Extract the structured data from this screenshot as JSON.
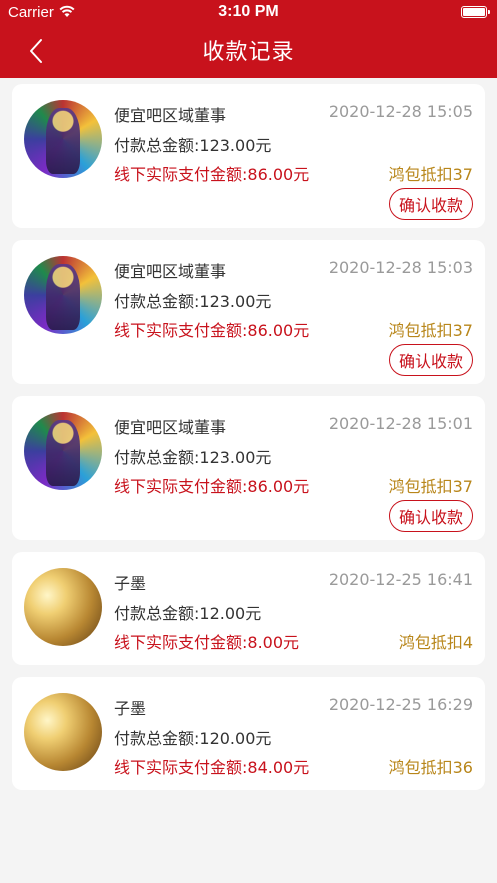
{
  "status_bar": {
    "carrier": "Carrier",
    "time": "3:10 PM"
  },
  "header": {
    "title": "收款记录"
  },
  "colors": {
    "brand": "#c8121c",
    "deduct": "#b8861a"
  },
  "records": [
    {
      "name": "便宜吧区域董事",
      "date": "2020-12-28 15:05",
      "total": "付款总金额:123.00元",
      "actual": "线下实际支付金额:86.00元",
      "deduct": "鸿包抵扣37",
      "confirm": "确认收款"
    },
    {
      "name": "便宜吧区域董事",
      "date": "2020-12-28 15:03",
      "total": "付款总金额:123.00元",
      "actual": "线下实际支付金额:86.00元",
      "deduct": "鸿包抵扣37",
      "confirm": "确认收款"
    },
    {
      "name": "便宜吧区域董事",
      "date": "2020-12-28 15:01",
      "total": "付款总金额:123.00元",
      "actual": "线下实际支付金额:86.00元",
      "deduct": "鸿包抵扣37",
      "confirm": "确认收款"
    },
    {
      "name": "子墨",
      "date": "2020-12-25 16:41",
      "total": "付款总金额:12.00元",
      "actual": "线下实际支付金额:8.00元",
      "deduct": "鸿包抵扣4"
    },
    {
      "name": "子墨",
      "date": "2020-12-25 16:29",
      "total": "付款总金额:120.00元",
      "actual": "线下实际支付金额:84.00元",
      "deduct": "鸿包抵扣36"
    }
  ]
}
